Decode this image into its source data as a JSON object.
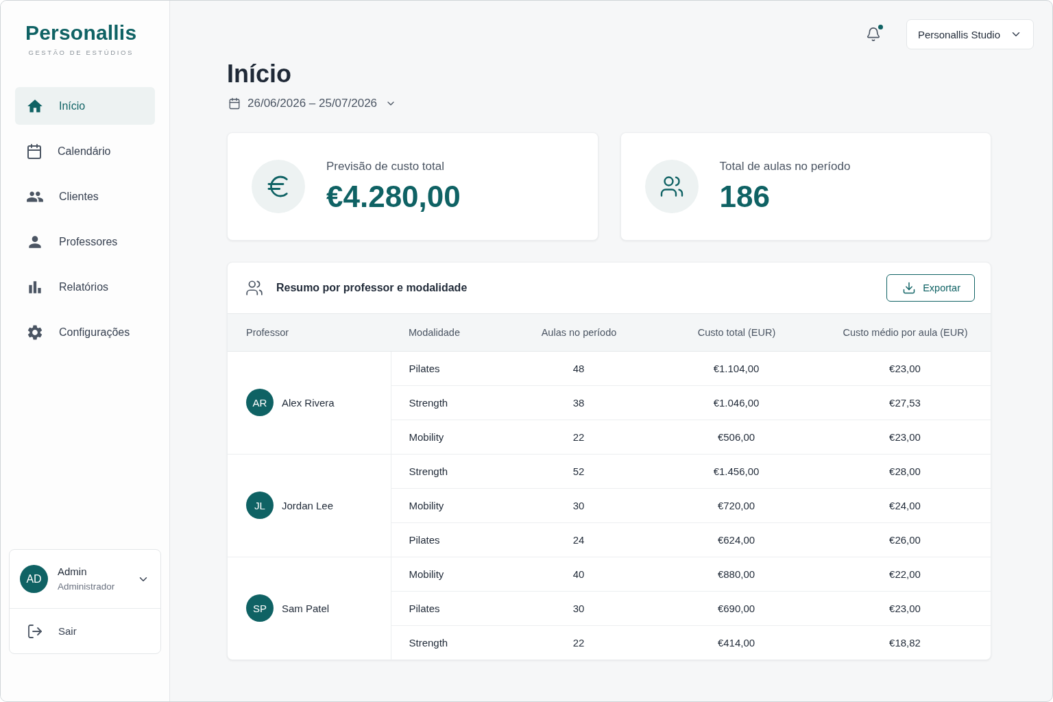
{
  "sidebar": {
    "logo": {
      "name": "Personallis",
      "tagline": "GESTÃO DE ESTÚDIOS"
    },
    "nav": [
      {
        "kind": "home",
        "label": "Início",
        "selected": true
      },
      {
        "kind": "calendar",
        "label": "Calendário",
        "selected": false
      },
      {
        "kind": "clients",
        "label": "Clientes",
        "selected": false
      },
      {
        "kind": "teachers",
        "label": "Professores",
        "selected": false
      },
      {
        "kind": "reports",
        "label": "Relatórios",
        "selected": false
      },
      {
        "kind": "settings",
        "label": "Configurações",
        "selected": false
      }
    ],
    "user": {
      "initials": "AD",
      "name": "Admin",
      "role": "Administrador",
      "expanded": false
    },
    "logout": {
      "label": "Sair"
    }
  },
  "topbar": {
    "notifications": {
      "unread": true
    },
    "studio": "Personallis Studio"
  },
  "page": {
    "title": "Início",
    "date_range": "26/06/2026 – 25/07/2026"
  },
  "stats": [
    {
      "kind": "currency",
      "label": "Previsão de custo total",
      "value": "€4.280,00"
    },
    {
      "kind": "count",
      "label": "Total de aulas no período",
      "value": "186"
    }
  ],
  "summary": {
    "title": "Resumo por professor e modalidade",
    "export": "Exportar",
    "columns": [
      "Professor",
      "Modalidade",
      "Aulas no período",
      "Custo total (EUR)",
      "Custo médio por aula (EUR)"
    ],
    "professors": [
      {
        "initials": "AR",
        "name": "Alex Rivera",
        "rows": [
          {
            "modality": "Pilates",
            "classes": "48",
            "total": "€1.104,00",
            "average": "€23,00"
          },
          {
            "modality": "Strength",
            "classes": "38",
            "total": "€1.046,00",
            "average": "€27,53"
          },
          {
            "modality": "Mobility",
            "classes": "22",
            "total": "€506,00",
            "average": "€23,00"
          }
        ]
      },
      {
        "initials": "JL",
        "name": "Jordan Lee",
        "rows": [
          {
            "modality": "Strength",
            "classes": "52",
            "total": "€1.456,00",
            "average": "€28,00"
          },
          {
            "modality": "Mobility",
            "classes": "30",
            "total": "€720,00",
            "average": "€24,00"
          },
          {
            "modality": "Pilates",
            "classes": "24",
            "total": "€624,00",
            "average": "€26,00"
          }
        ]
      },
      {
        "initials": "SP",
        "name": "Sam Patel",
        "rows": [
          {
            "modality": "Mobility",
            "classes": "40",
            "total": "€880,00",
            "average": "€22,00"
          },
          {
            "modality": "Pilates",
            "classes": "30",
            "total": "€690,00",
            "average": "€23,00"
          },
          {
            "modality": "Strength",
            "classes": "22",
            "total": "€414,00",
            "average": "€18,82"
          }
        ]
      }
    ]
  }
}
